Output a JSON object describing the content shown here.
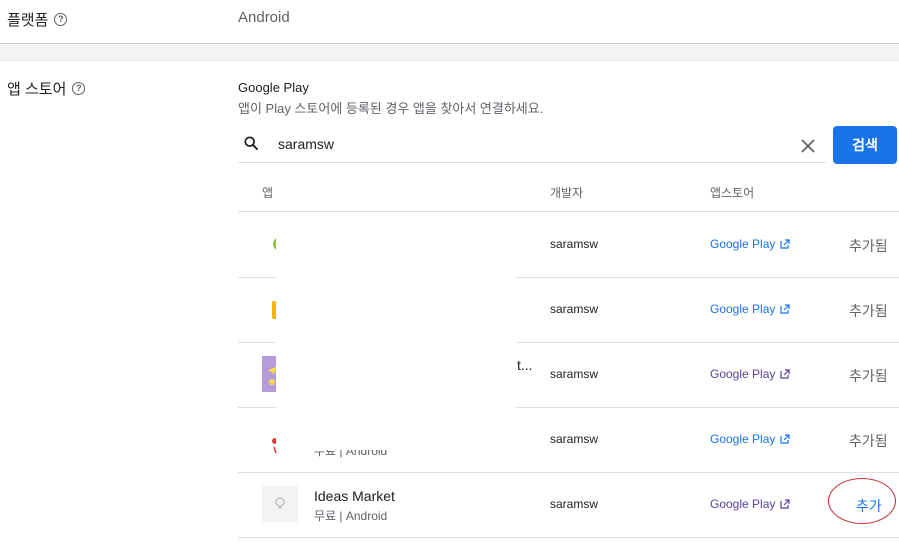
{
  "platform": {
    "label": "플랫폼",
    "value": "Android"
  },
  "app_store": {
    "label": "앱 스토어",
    "title": "Google Play",
    "description": "앱이 Play 스토어에 등록된 경우 앱을 찾아서 연결하세요.",
    "search": {
      "value": "saramsw",
      "button_label": "검색"
    }
  },
  "table": {
    "headers": {
      "app": "앱",
      "developer": "개발자",
      "store": "앱스토어"
    },
    "rows": [
      {
        "developer": "saramsw",
        "store": "Google Play",
        "status": "추가됨"
      },
      {
        "developer": "saramsw",
        "store": "Google Play",
        "status": "추가됨"
      },
      {
        "developer": "saramsw",
        "store": "Google Play",
        "status": "추가됨",
        "name_tail": "t..."
      },
      {
        "developer": "saramsw",
        "store": "Google Play",
        "status": "추가됨",
        "sub": "무료 | Android"
      },
      {
        "name": "Ideas Market",
        "sub": "무료 | Android",
        "developer": "saramsw",
        "store": "Google Play",
        "status": "추가"
      }
    ]
  },
  "colors": {
    "primary": "#1a73e8",
    "annotation": "#c0303a"
  }
}
